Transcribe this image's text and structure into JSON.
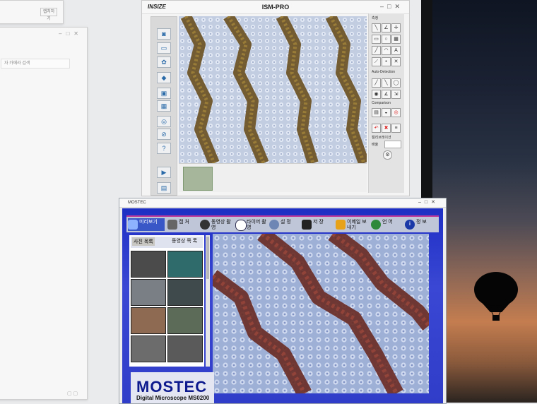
{
  "ism_pro": {
    "logo": "INSIZE",
    "title": "ISM-PRO",
    "right_panel": {
      "section_top": "측정",
      "section_auto": "Auto-Detection",
      "section_compare": "Comparison",
      "calib_label": "캘리브레이션",
      "calib_field_label": "배율"
    }
  },
  "left_windows": {
    "back_chip": "캡처하기",
    "search_placeholder": "자 카메라 검색"
  },
  "mostec": {
    "title": "MOSTEC",
    "toolbar": [
      {
        "label": "미리보기",
        "icon": "preview-icon"
      },
      {
        "label": "캡 처",
        "icon": "camera-icon"
      },
      {
        "label": "동영상 촬 영",
        "icon": "film-reel-icon"
      },
      {
        "label": "타이머 촬 영",
        "icon": "clock-icon"
      },
      {
        "label": "설 정",
        "icon": "settings-icon"
      },
      {
        "label": "저 장",
        "icon": "floppy-disk-icon"
      },
      {
        "label": "이메일 보내기",
        "icon": "email-icon"
      },
      {
        "label": "언 어",
        "icon": "globe-icon"
      },
      {
        "label": "정 보",
        "icon": "info-icon"
      }
    ],
    "side_tabs": {
      "photo": "사진 목록",
      "video": "동영상 목 록"
    },
    "brand": "MOSTEC",
    "model": "Digital Microscope MS0200"
  }
}
